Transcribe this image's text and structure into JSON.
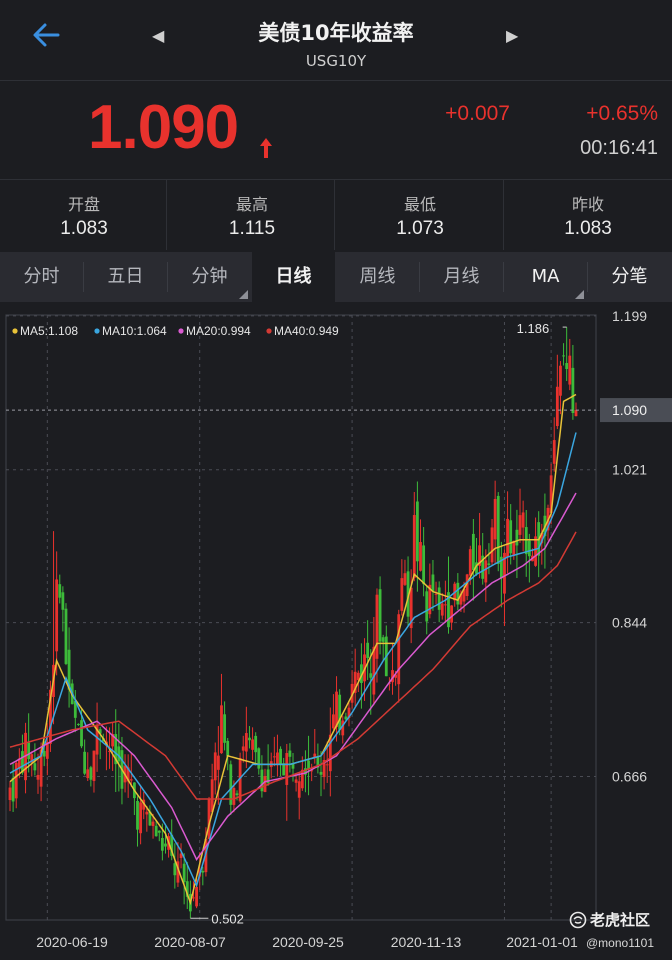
{
  "header": {
    "title": "美债10年收益率",
    "symbol": "USG10Y",
    "back_icon": "back-arrow-icon",
    "prev_icon": "triangle-left-icon",
    "next_icon": "triangle-right-icon"
  },
  "quote": {
    "price": "1.090",
    "change": "+0.007",
    "change_pct": "+0.65%",
    "time": "00:16:41",
    "direction_icon": "arrow-up-icon",
    "up_color": "#e8322d"
  },
  "stats": [
    {
      "label": "开盘",
      "value": "1.083"
    },
    {
      "label": "最高",
      "value": "1.115"
    },
    {
      "label": "最低",
      "value": "1.073"
    },
    {
      "label": "昨收",
      "value": "1.083"
    }
  ],
  "tabs": [
    {
      "label": "分时",
      "active": false,
      "has_menu": false
    },
    {
      "label": "五日",
      "active": false,
      "has_menu": false
    },
    {
      "label": "分钟",
      "active": false,
      "has_menu": true
    },
    {
      "label": "日线",
      "active": true,
      "has_menu": false
    },
    {
      "label": "周线",
      "active": false,
      "has_menu": false
    },
    {
      "label": "月线",
      "active": false,
      "has_menu": false
    },
    {
      "label": "MA",
      "active": false,
      "has_menu": true
    },
    {
      "label": "分笔",
      "active": false,
      "has_menu": false
    }
  ],
  "chart_data": {
    "type": "candlestick",
    "legend": [
      {
        "label": "MA5:1.108",
        "color": "#e8c238"
      },
      {
        "label": "MA10:1.064",
        "color": "#3aa6e0"
      },
      {
        "label": "MA20:0.994",
        "color": "#d95ad0"
      },
      {
        "label": "MA40:0.949",
        "color": "#d33a34"
      }
    ],
    "y_ticks": [
      "1.199",
      "1.021",
      "0.844",
      "0.666"
    ],
    "y_range": [
      0.5,
      1.2
    ],
    "current_price_label": "1.090",
    "current_price": 1.09,
    "high_label": "1.186",
    "high_value": 1.186,
    "low_label": "0.502",
    "low_value": 0.502,
    "x_ticks": [
      "2020-06-19",
      "2020-08-07",
      "2020-09-25",
      "2020-11-13",
      "2021-01-01"
    ],
    "up_color": "#e8322d",
    "down_color": "#3dbb3a",
    "grid": true,
    "close_path": [
      [
        0,
        0.65
      ],
      [
        3,
        0.68
      ],
      [
        6,
        0.7
      ],
      [
        9,
        0.67
      ],
      [
        12,
        0.72
      ],
      [
        14,
        0.82
      ],
      [
        16,
        0.9
      ],
      [
        18,
        0.8
      ],
      [
        20,
        0.74
      ],
      [
        23,
        0.7
      ],
      [
        26,
        0.68
      ],
      [
        29,
        0.73
      ],
      [
        32,
        0.7
      ],
      [
        35,
        0.68
      ],
      [
        38,
        0.66
      ],
      [
        41,
        0.63
      ],
      [
        44,
        0.62
      ],
      [
        47,
        0.6
      ],
      [
        50,
        0.58
      ],
      [
        53,
        0.56
      ],
      [
        56,
        0.54
      ],
      [
        58,
        0.51
      ],
      [
        60,
        0.55
      ],
      [
        62,
        0.58
      ],
      [
        64,
        0.63
      ],
      [
        66,
        0.7
      ],
      [
        68,
        0.73
      ],
      [
        70,
        0.67
      ],
      [
        72,
        0.66
      ],
      [
        75,
        0.71
      ],
      [
        78,
        0.69
      ],
      [
        81,
        0.67
      ],
      [
        84,
        0.66
      ],
      [
        87,
        0.69
      ],
      [
        90,
        0.68
      ],
      [
        93,
        0.7
      ],
      [
        96,
        0.69
      ],
      [
        99,
        0.67
      ],
      [
        102,
        0.7
      ],
      [
        105,
        0.73
      ],
      [
        108,
        0.75
      ],
      [
        111,
        0.78
      ],
      [
        114,
        0.8
      ],
      [
        116,
        0.82
      ],
      [
        118,
        0.85
      ],
      [
        120,
        0.82
      ],
      [
        122,
        0.77
      ],
      [
        124,
        0.8
      ],
      [
        126,
        0.9
      ],
      [
        128,
        0.87
      ],
      [
        130,
        0.95
      ],
      [
        132,
        0.91
      ],
      [
        134,
        0.86
      ],
      [
        136,
        0.88
      ],
      [
        138,
        0.85
      ],
      [
        140,
        0.87
      ],
      [
        142,
        0.88
      ],
      [
        144,
        0.86
      ],
      [
        146,
        0.88
      ],
      [
        148,
        0.91
      ],
      [
        150,
        0.93
      ],
      [
        152,
        0.91
      ],
      [
        154,
        0.95
      ],
      [
        156,
        0.96
      ],
      [
        158,
        0.92
      ],
      [
        160,
        0.94
      ],
      [
        162,
        0.93
      ],
      [
        164,
        0.94
      ],
      [
        166,
        0.95
      ],
      [
        168,
        0.93
      ],
      [
        170,
        0.94
      ],
      [
        172,
        0.95
      ],
      [
        174,
        1.03
      ],
      [
        176,
        1.1
      ],
      [
        178,
        1.15
      ],
      [
        180,
        1.13
      ],
      [
        182,
        1.09
      ]
    ],
    "ma_paths": {
      "MA5": [
        [
          0,
          0.66
        ],
        [
          10,
          0.69
        ],
        [
          15,
          0.8
        ],
        [
          20,
          0.76
        ],
        [
          30,
          0.71
        ],
        [
          40,
          0.65
        ],
        [
          50,
          0.6
        ],
        [
          58,
          0.52
        ],
        [
          64,
          0.61
        ],
        [
          70,
          0.69
        ],
        [
          80,
          0.68
        ],
        [
          90,
          0.68
        ],
        [
          100,
          0.69
        ],
        [
          110,
          0.76
        ],
        [
          118,
          0.82
        ],
        [
          124,
          0.82
        ],
        [
          130,
          0.9
        ],
        [
          136,
          0.88
        ],
        [
          144,
          0.87
        ],
        [
          150,
          0.91
        ],
        [
          156,
          0.93
        ],
        [
          164,
          0.94
        ],
        [
          170,
          0.94
        ],
        [
          174,
          0.97
        ],
        [
          178,
          1.1
        ],
        [
          182,
          1.108
        ]
      ],
      "MA10": [
        [
          0,
          0.67
        ],
        [
          10,
          0.69
        ],
        [
          18,
          0.78
        ],
        [
          25,
          0.72
        ],
        [
          35,
          0.69
        ],
        [
          45,
          0.64
        ],
        [
          55,
          0.58
        ],
        [
          60,
          0.54
        ],
        [
          68,
          0.64
        ],
        [
          78,
          0.68
        ],
        [
          90,
          0.68
        ],
        [
          100,
          0.69
        ],
        [
          110,
          0.74
        ],
        [
          120,
          0.8
        ],
        [
          130,
          0.85
        ],
        [
          140,
          0.87
        ],
        [
          150,
          0.9
        ],
        [
          160,
          0.92
        ],
        [
          170,
          0.93
        ],
        [
          176,
          0.98
        ],
        [
          182,
          1.064
        ]
      ],
      "MA20": [
        [
          0,
          0.68
        ],
        [
          15,
          0.71
        ],
        [
          28,
          0.73
        ],
        [
          40,
          0.69
        ],
        [
          52,
          0.63
        ],
        [
          60,
          0.57
        ],
        [
          70,
          0.62
        ],
        [
          82,
          0.66
        ],
        [
          95,
          0.67
        ],
        [
          105,
          0.69
        ],
        [
          115,
          0.74
        ],
        [
          125,
          0.79
        ],
        [
          135,
          0.83
        ],
        [
          145,
          0.86
        ],
        [
          155,
          0.89
        ],
        [
          165,
          0.91
        ],
        [
          172,
          0.93
        ],
        [
          182,
          0.994
        ]
      ],
      "MA40": [
        [
          0,
          0.7
        ],
        [
          20,
          0.72
        ],
        [
          35,
          0.73
        ],
        [
          50,
          0.69
        ],
        [
          60,
          0.64
        ],
        [
          72,
          0.64
        ],
        [
          85,
          0.66
        ],
        [
          100,
          0.68
        ],
        [
          112,
          0.71
        ],
        [
          124,
          0.75
        ],
        [
          136,
          0.79
        ],
        [
          148,
          0.84
        ],
        [
          160,
          0.87
        ],
        [
          170,
          0.89
        ],
        [
          176,
          0.91
        ],
        [
          182,
          0.949
        ]
      ]
    }
  },
  "watermark": {
    "logo_icon": "tiger-logo-icon",
    "text": "老虎社区",
    "user": "@mono1101"
  }
}
